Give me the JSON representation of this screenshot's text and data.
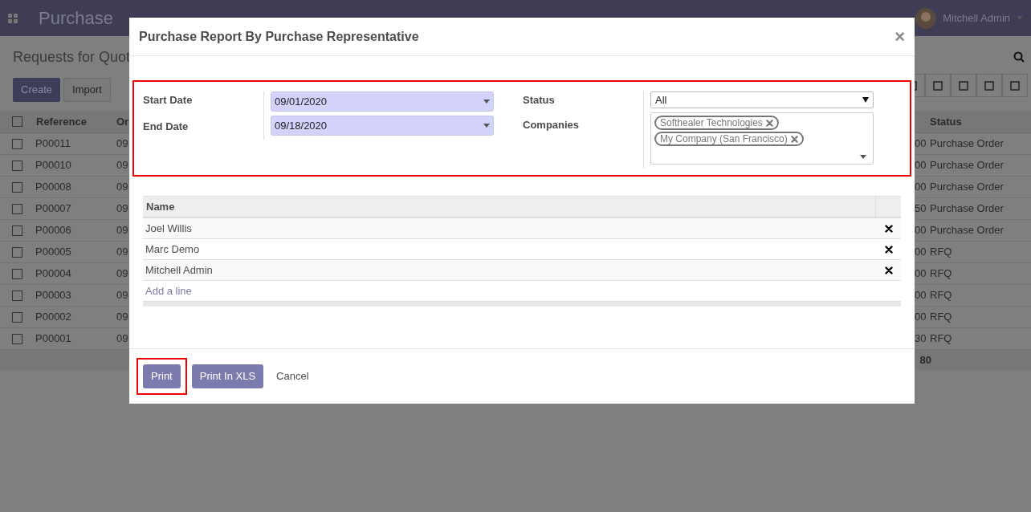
{
  "app": {
    "title": "Purchase",
    "user": "Mitchell Admin",
    "breadcrumb": "Requests for Quot",
    "buttons": [
      "Create",
      "Import"
    ],
    "table": {
      "all_checked": false,
      "columns": [
        "Reference",
        "Or",
        "Status"
      ],
      "rows": [
        {
          "checked": false,
          "reference": "P00011",
          "column_2": "09",
          "amount": "00",
          "status": "Purchase Order"
        },
        {
          "checked": false,
          "reference": "P00010",
          "column_2": "09",
          "amount": "00",
          "status": "Purchase Order"
        },
        {
          "checked": false,
          "reference": "P00008",
          "column_2": "09",
          "amount": "00",
          "status": "Purchase Order"
        },
        {
          "checked": false,
          "reference": "P00007",
          "column_2": "09",
          "amount": "50",
          "status": "Purchase Order"
        },
        {
          "checked": false,
          "reference": "P00006",
          "column_2": "09",
          "amount": "00",
          "status": "Purchase Order"
        },
        {
          "checked": false,
          "reference": "P00005",
          "column_2": "09",
          "amount": "00",
          "status": "RFQ"
        },
        {
          "checked": false,
          "reference": "P00004",
          "column_2": "09",
          "amount": "00",
          "status": "RFQ"
        },
        {
          "checked": false,
          "reference": "P00003",
          "column_2": "09",
          "amount": "00",
          "status": "RFQ"
        },
        {
          "checked": false,
          "reference": "P00002",
          "column_2": "09",
          "amount": "00",
          "status": "RFQ"
        },
        {
          "checked": false,
          "reference": "P00001",
          "column_2": "09",
          "amount": "30",
          "status": "RFQ"
        }
      ],
      "total": "80"
    }
  },
  "dialog": {
    "title": "Purchase Report By Purchase Representative",
    "close": "×",
    "form": {
      "highlighted": true,
      "start_date": {
        "label": "Start Date",
        "value": "09/01/2020"
      },
      "end_date": {
        "label": "End Date",
        "value": "09/18/2020"
      },
      "status": {
        "label": "Status",
        "value": "All"
      },
      "companies": {
        "label": "Companies",
        "tags": [
          "Softhealer Technologies",
          "My Company (San Francisco)"
        ]
      }
    },
    "table": {
      "columns": [
        "Name"
      ],
      "rows": [
        "Joel Willis",
        "Marc Demo",
        "Mitchell Admin"
      ],
      "add_line": "Add a line"
    },
    "buttons": [
      {
        "label": "Print",
        "kind": "primary",
        "highlighted": true
      },
      {
        "label": "Print In XLS",
        "kind": "primary",
        "highlighted": false
      },
      {
        "label": "Cancel",
        "kind": "link",
        "highlighted": false
      }
    ]
  }
}
